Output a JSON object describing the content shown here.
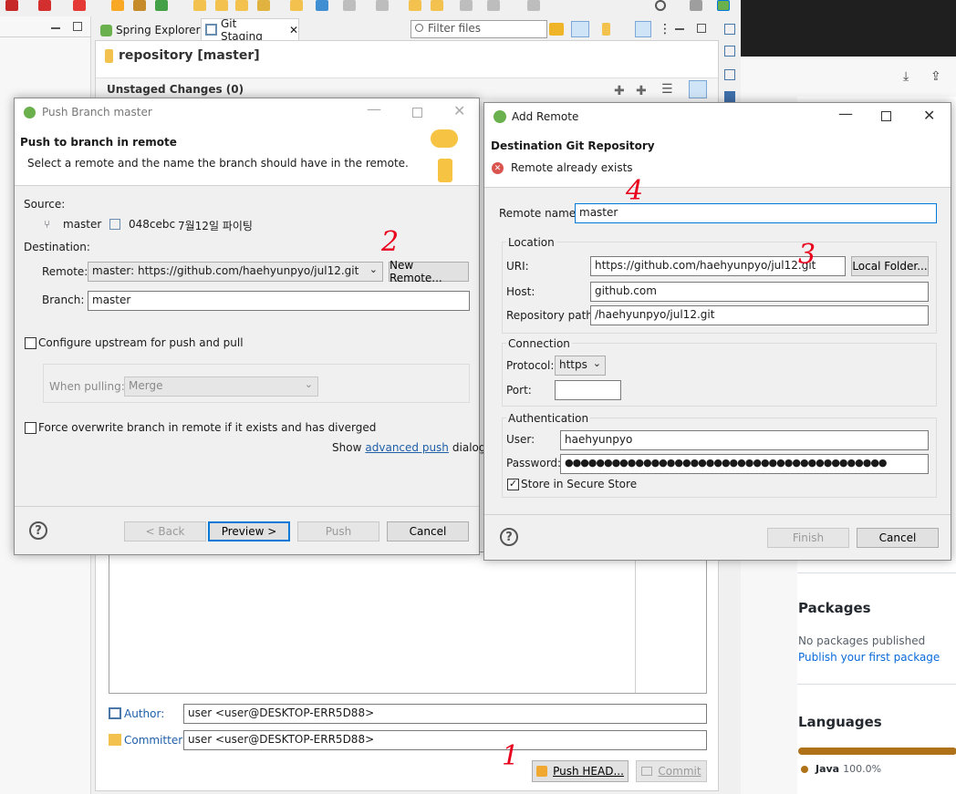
{
  "eclipse": {
    "tabs": [
      "Spring Explorer",
      "Git Staging"
    ],
    "filter_placeholder": "Filter files",
    "repo_title": "repository [master]",
    "unstaged": "Unstaged Changes (0)",
    "author_label": "Author:",
    "author_value": "user <user@DESKTOP-ERR5D88>",
    "committer_label": "Committer:",
    "committer_value": "user <user@DESKTOP-ERR5D88>",
    "push_head": "Push HEAD...",
    "commit": "Commit"
  },
  "github": {
    "packages_heading": "Packages",
    "no_packages": "No packages published",
    "publish_link": "Publish your first package",
    "languages_heading": "Languages",
    "lang_name": "Java",
    "lang_pct": "100.0%",
    "lang_color": "#b07219"
  },
  "push_dialog": {
    "title": "Push Branch master",
    "heading": "Push to branch in remote",
    "subtitle": "Select a remote and the name the branch should have in the remote.",
    "source_label": "Source:",
    "source_branch": "master",
    "source_commit": "048cebc",
    "source_message": "7월12일 파이팅",
    "destination_label": "Destination:",
    "remote_label": "Remote:",
    "remote_value": "master: https://github.com/haehyunpyo/jul12.git",
    "new_remote": "New Remote...",
    "branch_label": "Branch:",
    "branch_value": "master",
    "configure_upstream": "Configure upstream for push and pull",
    "when_pulling": "When pulling:",
    "when_pulling_value": "Merge",
    "force_overwrite": "Force overwrite branch in remote if it exists and has diverged",
    "show": "Show",
    "advanced_push": "advanced push",
    "dialog_word": "dialog",
    "back": "< Back",
    "preview": "Preview >",
    "push": "Push",
    "cancel": "Cancel"
  },
  "add_remote": {
    "title": "Add Remote",
    "heading": "Destination Git Repository",
    "error": "Remote already exists",
    "remote_name_label": "Remote name:",
    "remote_name_value": "master",
    "location": "Location",
    "uri_label": "URI:",
    "uri_value": "https://github.com/haehyunpyo/jul12.git",
    "local_folder": "Local Folder...",
    "host_label": "Host:",
    "host_value": "github.com",
    "repo_path_label": "Repository path:",
    "repo_path_value": "/haehyunpyo/jul12.git",
    "connection": "Connection",
    "protocol_label": "Protocol:",
    "protocol_value": "https",
    "port_label": "Port:",
    "port_value": "",
    "authentication": "Authentication",
    "user_label": "User:",
    "user_value": "haehyunpyo",
    "password_label": "Password:",
    "password_value": "●●●●●●●●●●●●●●●●●●●●●●●●●●●●●●●●●●●●●●●●●",
    "store_secure": "Store in Secure Store",
    "finish": "Finish",
    "cancel": "Cancel"
  },
  "annotations": [
    "1",
    "2",
    "3",
    "4"
  ]
}
